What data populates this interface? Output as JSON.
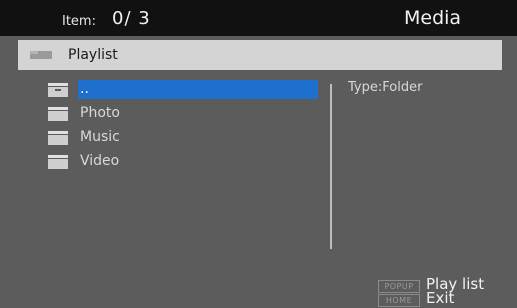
{
  "header": {
    "item_label": "Item:",
    "item_count": "0/ 3",
    "title": "Media"
  },
  "path": {
    "icon": "folder-icon",
    "label": "Playlist"
  },
  "files": [
    {
      "name": "..",
      "icon": "folder-up-icon",
      "selected": true
    },
    {
      "name": "Photo",
      "icon": "folder-icon",
      "selected": false
    },
    {
      "name": "Music",
      "icon": "folder-icon",
      "selected": false
    },
    {
      "name": "Video",
      "icon": "folder-icon",
      "selected": false
    }
  ],
  "info": {
    "type_text": "Type:Folder"
  },
  "help": [
    {
      "key": "POPUP",
      "action": "Play list"
    },
    {
      "key": "HOME",
      "action": "Exit"
    }
  ],
  "colors": {
    "background": "#5c5c5c",
    "header": "#111111",
    "pathbar": "#d4d4d4",
    "selection": "#1f6fcf"
  }
}
